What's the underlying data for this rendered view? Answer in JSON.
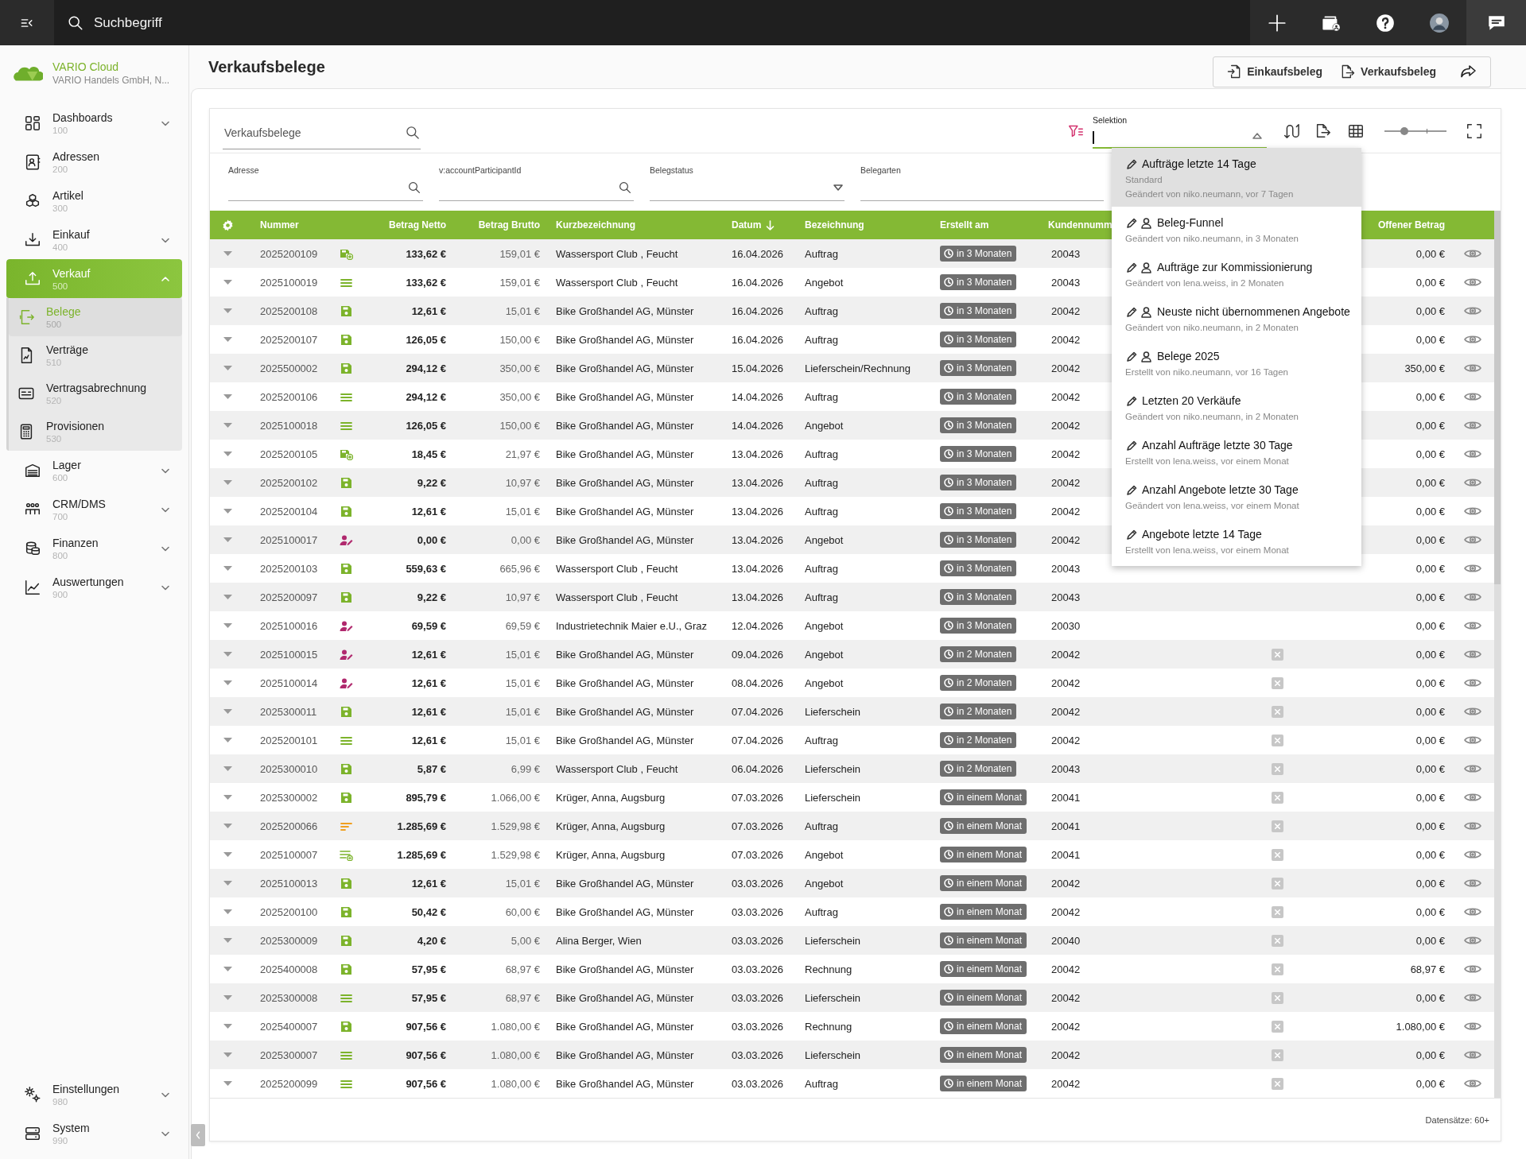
{
  "top_bar": {
    "search": {
      "placeholder": "Suchbegriff"
    }
  },
  "sidebar": {
    "brand": {
      "name": "VARIO Cloud",
      "company": "VARIO Handels GmbH, N..."
    },
    "items": [
      {
        "label": "Dashboards",
        "code": "100",
        "expanded": false,
        "selected": false
      },
      {
        "label": "Adressen",
        "code": "200",
        "selected": false
      },
      {
        "label": "Artikel",
        "code": "300",
        "selected": false
      },
      {
        "label": "Einkauf",
        "code": "400",
        "expanded": false,
        "selected": false
      },
      {
        "label": "Verkauf",
        "code": "500",
        "expanded": true,
        "selected": true,
        "children": [
          {
            "label": "Belege",
            "code": "500",
            "selected": true
          },
          {
            "label": "Verträge",
            "code": "510",
            "selected": false
          },
          {
            "label": "Vertragsabrechnung",
            "code": "520",
            "selected": false
          },
          {
            "label": "Provisionen",
            "code": "530",
            "selected": false
          }
        ]
      },
      {
        "label": "Lager",
        "code": "600",
        "expanded": false,
        "selected": false
      },
      {
        "label": "CRM/DMS",
        "code": "700",
        "expanded": false,
        "selected": false
      },
      {
        "label": "Finanzen",
        "code": "800",
        "expanded": false,
        "selected": false
      },
      {
        "label": "Auswertungen",
        "code": "900",
        "expanded": false,
        "selected": false
      }
    ],
    "bottom_items": [
      {
        "label": "Einstellungen",
        "code": "980",
        "expanded": false,
        "selected": false
      },
      {
        "label": "System",
        "code": "990",
        "expanded": false,
        "selected": false
      }
    ]
  },
  "page": {
    "title": "Verkaufsbelege",
    "actions": [
      {
        "label": "Einkaufsbeleg"
      },
      {
        "label": "Verkaufsbeleg"
      }
    ]
  },
  "search": {
    "placeholder": "Verkaufsbelege"
  },
  "selection": {
    "label": "Selektion",
    "expanded": true,
    "options": [
      {
        "title": "Aufträge letzte 14 Tage",
        "personal": false,
        "subtitle": "Standard",
        "meta": "Geändert von niko.neumann, vor 7 Tagen",
        "selected": true
      },
      {
        "title": "Beleg-Funnel",
        "personal": true,
        "meta": "Geändert von niko.neumann, in 3 Monaten",
        "selected": false
      },
      {
        "title": "Aufträge zur Kommissionierung",
        "personal": true,
        "meta": "Geändert von lena.weiss, in 2 Monaten",
        "selected": false
      },
      {
        "title": "Neuste nicht übernommenen Angebote",
        "personal": true,
        "meta": "Geändert von niko.neumann, in 2 Monaten",
        "selected": false
      },
      {
        "title": "Belege 2025",
        "personal": true,
        "meta": "Erstellt von niko.neumann, vor 16 Tagen",
        "selected": false
      },
      {
        "title": "Letzten 20 Verkäufe",
        "personal": false,
        "meta": "Geändert von niko.neumann, in 2 Monaten",
        "selected": false
      },
      {
        "title": "Anzahl Aufträge letzte 30 Tage",
        "personal": false,
        "meta": "Erstellt von lena.weiss, vor einem Monat",
        "selected": false
      },
      {
        "title": "Anzahl Angebote letzte 30 Tage",
        "personal": false,
        "meta": "Geändert von lena.weiss, vor einem Monat",
        "selected": false
      },
      {
        "title": "Angebote letzte 14 Tage",
        "personal": false,
        "meta": "Erstellt von lena.weiss, vor einem Monat",
        "selected": false
      }
    ]
  },
  "zoom_slider": {
    "level": 0.32
  },
  "filters": [
    {
      "label": "Adresse",
      "kind": "search"
    },
    {
      "label": "v:accountParticipantId",
      "kind": "search"
    },
    {
      "label": "Belegstatus",
      "kind": "select"
    },
    {
      "label": "Belegarten",
      "kind": "text"
    }
  ],
  "table": {
    "columns": [
      {
        "label": "Nummer"
      },
      {
        "label": "Betrag Netto"
      },
      {
        "label": "Betrag Brutto"
      },
      {
        "label": "Kurzbezeichnung"
      },
      {
        "label": "Datum",
        "descending": true
      },
      {
        "label": "Bezeichnung"
      },
      {
        "label": "Erstellt am"
      },
      {
        "label": "Kundennumm"
      },
      {
        "label": "Offener Betrag"
      }
    ],
    "rows": [
      {
        "number": "2025200109",
        "status": {
          "kind": "converted"
        },
        "net": "133,62 €",
        "gross": "159,01 €",
        "short_name": "Wassersport Club , Feucht",
        "date": "16.04.2026",
        "designation": "Auftrag",
        "created": "in 3 Monaten",
        "customer_no": "20043",
        "open_amount": "0,00 €"
      },
      {
        "number": "2025100019",
        "status": {
          "kind": "open"
        },
        "net": "133,62 €",
        "gross": "159,01 €",
        "short_name": "Wassersport Club , Feucht",
        "date": "16.04.2026",
        "designation": "Angebot",
        "created": "in 3 Monaten",
        "customer_no": "20043",
        "open_amount": "0,00 €"
      },
      {
        "number": "2025200108",
        "status": {
          "kind": "saved"
        },
        "net": "12,61 €",
        "gross": "15,01 €",
        "short_name": "Bike Großhandel AG, Münster",
        "date": "16.04.2026",
        "designation": "Auftrag",
        "created": "in 3 Monaten",
        "customer_no": "20042",
        "open_amount": "0,00 €"
      },
      {
        "number": "2025200107",
        "status": {
          "kind": "saved"
        },
        "net": "126,05 €",
        "gross": "150,00 €",
        "short_name": "Bike Großhandel AG, Münster",
        "date": "16.04.2026",
        "designation": "Auftrag",
        "created": "in 3 Monaten",
        "customer_no": "20042",
        "open_amount": "0,00 €"
      },
      {
        "number": "2025500002",
        "status": {
          "kind": "saved"
        },
        "net": "294,12 €",
        "gross": "350,00 €",
        "short_name": "Bike Großhandel AG, Münster",
        "date": "15.04.2026",
        "designation": "Lieferschein/Rechnung",
        "created": "in 3 Monaten",
        "customer_no": "20042",
        "open_amount": "350,00 €"
      },
      {
        "number": "2025200106",
        "status": {
          "kind": "open"
        },
        "net": "294,12 €",
        "gross": "350,00 €",
        "short_name": "Bike Großhandel AG, Münster",
        "date": "14.04.2026",
        "designation": "Auftrag",
        "created": "in 3 Monaten",
        "customer_no": "20042",
        "open_amount": "0,00 €"
      },
      {
        "number": "2025100018",
        "status": {
          "kind": "open"
        },
        "net": "126,05 €",
        "gross": "150,00 €",
        "short_name": "Bike Großhandel AG, Münster",
        "date": "14.04.2026",
        "designation": "Angebot",
        "created": "in 3 Monaten",
        "customer_no": "20042",
        "open_amount": "0,00 €"
      },
      {
        "number": "2025200105",
        "status": {
          "kind": "converted"
        },
        "net": "18,45 €",
        "gross": "21,97 €",
        "short_name": "Bike Großhandel AG, Münster",
        "date": "13.04.2026",
        "designation": "Auftrag",
        "created": "in 3 Monaten",
        "customer_no": "20042",
        "open_amount": "0,00 €"
      },
      {
        "number": "2025200102",
        "status": {
          "kind": "saved"
        },
        "net": "9,22 €",
        "gross": "10,97 €",
        "short_name": "Bike Großhandel AG, Münster",
        "date": "13.04.2026",
        "designation": "Auftrag",
        "created": "in 3 Monaten",
        "customer_no": "20042",
        "open_amount": "0,00 €"
      },
      {
        "number": "2025200104",
        "status": {
          "kind": "saved"
        },
        "net": "12,61 €",
        "gross": "15,01 €",
        "short_name": "Bike Großhandel AG, Münster",
        "date": "13.04.2026",
        "designation": "Auftrag",
        "created": "in 3 Monaten",
        "customer_no": "20042",
        "open_amount": "0,00 €"
      },
      {
        "number": "2025100017",
        "status": {
          "kind": "assigned"
        },
        "net": "0,00 €",
        "gross": "0,00 €",
        "short_name": "Bike Großhandel AG, Münster",
        "date": "13.04.2026",
        "designation": "Angebot",
        "created": "in 3 Monaten",
        "customer_no": "20042",
        "open_amount": "0,00 €"
      },
      {
        "number": "2025200103",
        "status": {
          "kind": "saved"
        },
        "net": "559,63 €",
        "gross": "665,96 €",
        "short_name": "Wassersport Club , Feucht",
        "date": "13.04.2026",
        "designation": "Auftrag",
        "created": "in 3 Monaten",
        "customer_no": "20043",
        "open_amount": "0,00 €"
      },
      {
        "number": "2025200097",
        "status": {
          "kind": "saved"
        },
        "net": "9,22 €",
        "gross": "10,97 €",
        "short_name": "Wassersport Club , Feucht",
        "date": "13.04.2026",
        "designation": "Auftrag",
        "created": "in 3 Monaten",
        "customer_no": "20043",
        "open_amount": "0,00 €"
      },
      {
        "number": "2025100016",
        "status": {
          "kind": "assigned"
        },
        "net": "69,59 €",
        "gross": "69,59 €",
        "short_name": "Industrietechnik Maier e.U., Graz",
        "date": "12.04.2026",
        "designation": "Angebot",
        "created": "in 3 Monaten",
        "customer_no": "20030",
        "open_amount": "0,00 €"
      },
      {
        "number": "2025100015",
        "status": {
          "kind": "assigned"
        },
        "net": "12,61 €",
        "gross": "15,01 €",
        "short_name": "Bike Großhandel AG, Münster",
        "date": "09.04.2026",
        "designation": "Angebot",
        "created": "in 2 Monaten",
        "customer_no": "20042",
        "checked": false,
        "open_amount": "0,00 €"
      },
      {
        "number": "2025100014",
        "status": {
          "kind": "assigned"
        },
        "net": "12,61 €",
        "gross": "15,01 €",
        "short_name": "Bike Großhandel AG, Münster",
        "date": "08.04.2026",
        "designation": "Angebot",
        "created": "in 2 Monaten",
        "customer_no": "20042",
        "checked": false,
        "open_amount": "0,00 €"
      },
      {
        "number": "2025300011",
        "status": {
          "kind": "saved"
        },
        "net": "12,61 €",
        "gross": "15,01 €",
        "short_name": "Bike Großhandel AG, Münster",
        "date": "07.04.2026",
        "designation": "Lieferschein",
        "created": "in 2 Monaten",
        "customer_no": "20042",
        "checked": false,
        "open_amount": "0,00 €"
      },
      {
        "number": "2025200101",
        "status": {
          "kind": "open"
        },
        "net": "12,61 €",
        "gross": "15,01 €",
        "short_name": "Bike Großhandel AG, Münster",
        "date": "07.04.2026",
        "designation": "Auftrag",
        "created": "in 2 Monaten",
        "customer_no": "20042",
        "checked": false,
        "open_amount": "0,00 €"
      },
      {
        "number": "2025300010",
        "status": {
          "kind": "saved"
        },
        "net": "5,87 €",
        "gross": "6,99 €",
        "short_name": "Wassersport Club , Feucht",
        "date": "06.04.2026",
        "designation": "Lieferschein",
        "created": "in 2 Monaten",
        "customer_no": "20043",
        "checked": false,
        "open_amount": "0,00 €"
      },
      {
        "number": "2025300002",
        "status": {
          "kind": "saved"
        },
        "net": "895,79 €",
        "gross": "1.066,00 €",
        "short_name": "Krüger, Anna, Augsburg",
        "date": "07.03.2026",
        "designation": "Lieferschein",
        "created": "in einem Monat",
        "customer_no": "20041",
        "checked": false,
        "open_amount": "0,00 €"
      },
      {
        "number": "2025200066",
        "status": {
          "kind": "partial"
        },
        "net": "1.285,69 €",
        "gross": "1.529,98 €",
        "short_name": "Krüger, Anna, Augsburg",
        "date": "07.03.2026",
        "designation": "Auftrag",
        "created": "in einem Monat",
        "customer_no": "20041",
        "checked": false,
        "open_amount": "0,00 €"
      },
      {
        "number": "2025100007",
        "status": {
          "kind": "open_new"
        },
        "net": "1.285,69 €",
        "gross": "1.529,98 €",
        "short_name": "Krüger, Anna, Augsburg",
        "date": "07.03.2026",
        "designation": "Angebot",
        "created": "in einem Monat",
        "customer_no": "20041",
        "checked": false,
        "open_amount": "0,00 €"
      },
      {
        "number": "2025100013",
        "status": {
          "kind": "saved"
        },
        "net": "12,61 €",
        "gross": "15,01 €",
        "short_name": "Bike Großhandel AG, Münster",
        "date": "03.03.2026",
        "designation": "Angebot",
        "created": "in einem Monat",
        "customer_no": "20042",
        "checked": false,
        "open_amount": "0,00 €"
      },
      {
        "number": "2025200100",
        "status": {
          "kind": "saved"
        },
        "net": "50,42 €",
        "gross": "60,00 €",
        "short_name": "Bike Großhandel AG, Münster",
        "date": "03.03.2026",
        "designation": "Auftrag",
        "created": "in einem Monat",
        "customer_no": "20042",
        "checked": false,
        "open_amount": "0,00 €"
      },
      {
        "number": "2025300009",
        "status": {
          "kind": "saved"
        },
        "net": "4,20 €",
        "gross": "5,00 €",
        "short_name": "Alina Berger, Wien",
        "date": "03.03.2026",
        "designation": "Lieferschein",
        "created": "in einem Monat",
        "customer_no": "20040",
        "checked": false,
        "open_amount": "0,00 €"
      },
      {
        "number": "2025400008",
        "status": {
          "kind": "saved"
        },
        "net": "57,95 €",
        "gross": "68,97 €",
        "short_name": "Bike Großhandel AG, Münster",
        "date": "03.03.2026",
        "designation": "Rechnung",
        "created": "in einem Monat",
        "customer_no": "20042",
        "checked": false,
        "open_amount": "68,97 €"
      },
      {
        "number": "2025300008",
        "status": {
          "kind": "open"
        },
        "net": "57,95 €",
        "gross": "68,97 €",
        "short_name": "Bike Großhandel AG, Münster",
        "date": "03.03.2026",
        "designation": "Lieferschein",
        "created": "in einem Monat",
        "customer_no": "20042",
        "checked": false,
        "open_amount": "0,00 €"
      },
      {
        "number": "2025400007",
        "status": {
          "kind": "saved"
        },
        "net": "907,56 €",
        "gross": "1.080,00 €",
        "short_name": "Bike Großhandel AG, Münster",
        "date": "03.03.2026",
        "designation": "Rechnung",
        "created": "in einem Monat",
        "customer_no": "20042",
        "checked": false,
        "open_amount": "1.080,00 €"
      },
      {
        "number": "2025300007",
        "status": {
          "kind": "open"
        },
        "net": "907,56 €",
        "gross": "1.080,00 €",
        "short_name": "Bike Großhandel AG, Münster",
        "date": "03.03.2026",
        "designation": "Lieferschein",
        "created": "in einem Monat",
        "customer_no": "20042",
        "checked": false,
        "open_amount": "0,00 €"
      },
      {
        "number": "2025200099",
        "status": {
          "kind": "open"
        },
        "net": "907,56 €",
        "gross": "1.080,00 €",
        "short_name": "Bike Großhandel AG, Münster",
        "date": "03.03.2026",
        "designation": "Auftrag",
        "created": "in einem Monat",
        "customer_no": "20042",
        "checked": false,
        "open_amount": "0,00 €"
      }
    ]
  },
  "footer": {
    "record_count": "Datensätze: 60+"
  }
}
